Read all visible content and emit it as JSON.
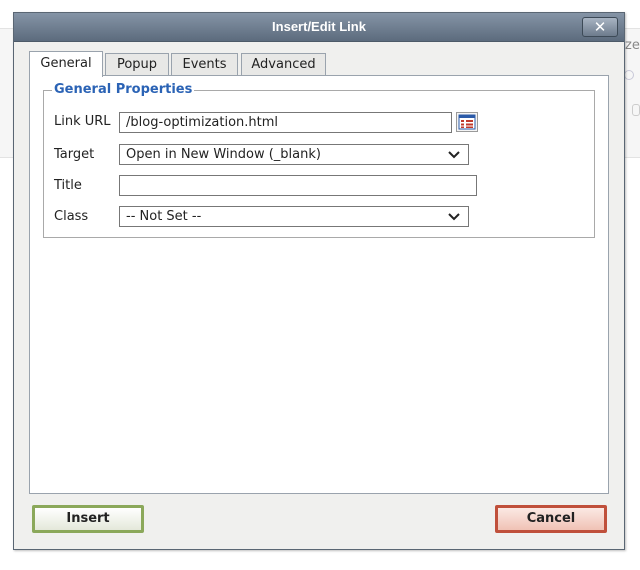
{
  "background": {
    "partial_text": "ze"
  },
  "dialog": {
    "title": "Insert/Edit Link",
    "close_label": "✕"
  },
  "tabs": [
    {
      "label": "General",
      "active": true
    },
    {
      "label": "Popup",
      "active": false
    },
    {
      "label": "Events",
      "active": false
    },
    {
      "label": "Advanced",
      "active": false
    }
  ],
  "general": {
    "legend": "General Properties",
    "link_url": {
      "label": "Link URL",
      "value": "/blog-optimization.html",
      "browse_icon": "browse-icon"
    },
    "target": {
      "label": "Target",
      "value": "Open in New Window (_blank)"
    },
    "title": {
      "label": "Title",
      "value": ""
    },
    "class": {
      "label": "Class",
      "value": "-- Not Set --"
    }
  },
  "buttons": {
    "insert": "Insert",
    "cancel": "Cancel"
  },
  "colors": {
    "legend": "#2b63b5",
    "insert_border": "#8ba85a",
    "cancel_border": "#c0503b",
    "titlebar": "#6a798b"
  }
}
